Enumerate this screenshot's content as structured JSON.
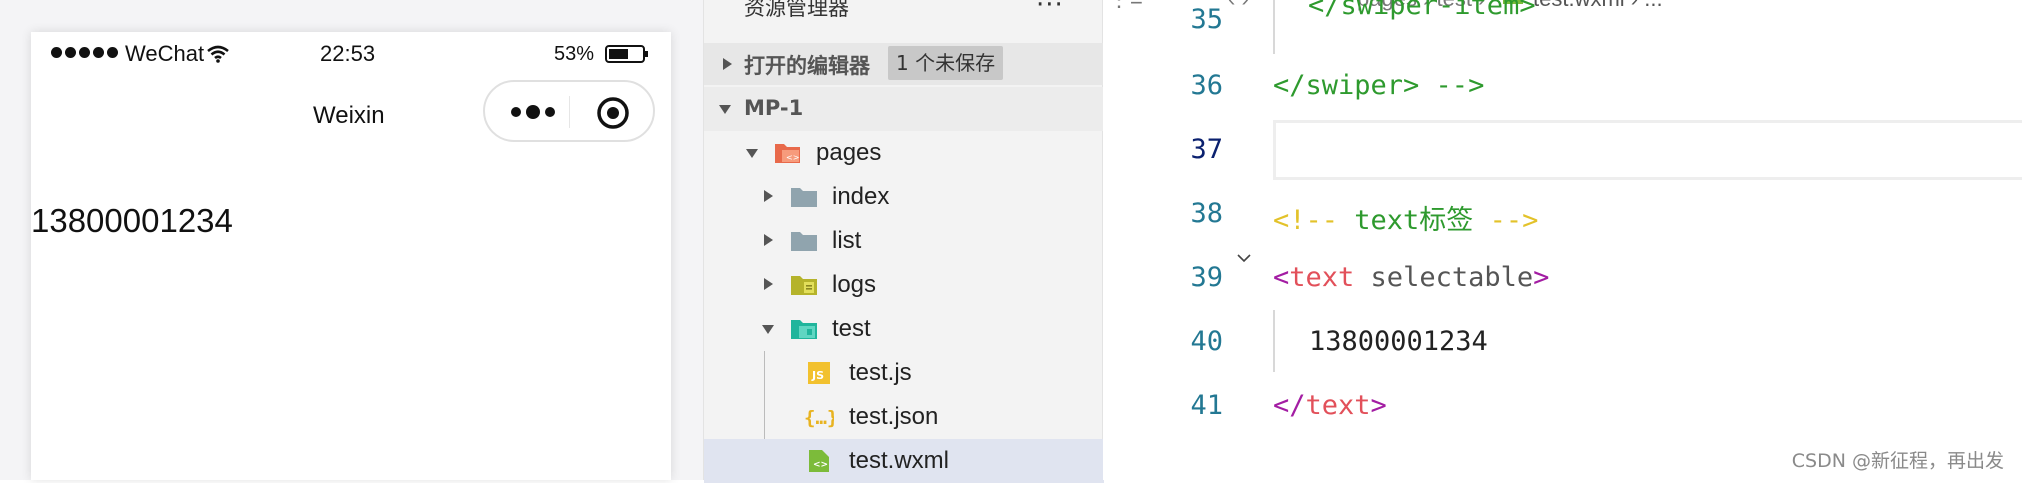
{
  "simulator": {
    "status": {
      "carrier": "WeChat",
      "time": "22:53",
      "battery_pct": "53%"
    },
    "nav_title": "Weixin",
    "content_text": "13800001234"
  },
  "explorer": {
    "title": "资源管理器",
    "more": "···",
    "open_editors": {
      "label": "打开的编辑器",
      "badge": "1 个未保存"
    },
    "project": {
      "label": "MP-1"
    },
    "tree": [
      {
        "label": "pages",
        "icon": "folder-open-pages-icon"
      },
      {
        "label": "index",
        "icon": "folder-icon"
      },
      {
        "label": "list",
        "icon": "folder-icon"
      },
      {
        "label": "logs",
        "icon": "folder-logs-icon"
      },
      {
        "label": "test",
        "icon": "folder-open-test-icon"
      },
      {
        "label": "test.js",
        "icon": "js-file-icon"
      },
      {
        "label": "test.json",
        "icon": "json-file-icon"
      },
      {
        "label": "test.wxml",
        "icon": "wxml-file-icon"
      }
    ]
  },
  "editor": {
    "breadcrumb": {
      "path": "pages › test ›",
      "file": "test.wxml › ..."
    },
    "lines": [
      {
        "num": "35",
        "text": "</swiper-item>"
      },
      {
        "num": "36",
        "text": "</swiper> -->"
      },
      {
        "num": "37",
        "text": ""
      },
      {
        "num": "38",
        "comment_open": "<!-- ",
        "comment_body": "text标签",
        "comment_close": " -->"
      },
      {
        "num": "39",
        "open": "<",
        "tag": "text",
        "attr": " selectable",
        "close": ">"
      },
      {
        "num": "40",
        "text": "13800001234"
      },
      {
        "num": "41",
        "open": "</",
        "tag": "text",
        "close": ">"
      }
    ]
  },
  "watermark": "CSDN @新征程，再出发",
  "colors": {
    "line_number": "#237893",
    "tag_green": "#2e9a2e",
    "comment_yellow": "#e3c22a",
    "tag_purple": "#a31da3",
    "tag_red": "#e2505a",
    "selected_row": "#e0e4f0"
  }
}
